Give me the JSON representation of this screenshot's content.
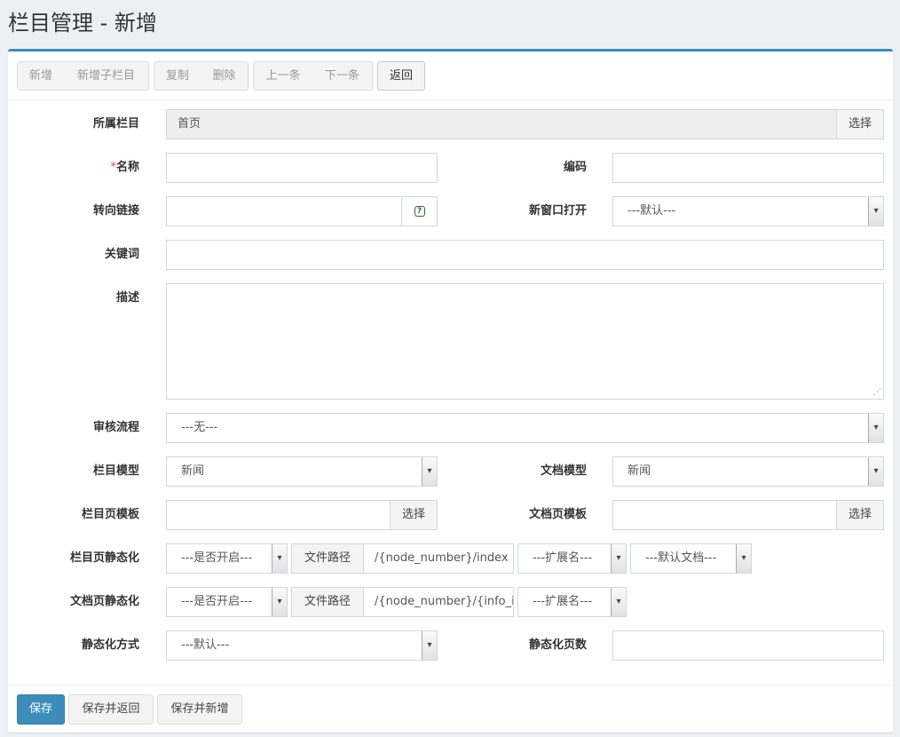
{
  "page": {
    "title": "栏目管理 - 新增"
  },
  "toolbar": {
    "add": "新增",
    "add_child": "新增子栏目",
    "copy": "复制",
    "delete": "删除",
    "prev": "上一条",
    "next": "下一条",
    "back": "返回"
  },
  "form": {
    "parent": {
      "label": "所属栏目",
      "value": "首页",
      "button": "选择"
    },
    "name": {
      "required_mark": "*",
      "label": "名称",
      "value": ""
    },
    "code": {
      "label": "编码",
      "value": ""
    },
    "redirect": {
      "label": "转向链接",
      "value": "",
      "help": "?"
    },
    "new_window": {
      "label": "新窗口打开",
      "selected": "---默认---"
    },
    "keywords": {
      "label": "关键词",
      "value": ""
    },
    "description": {
      "label": "描述",
      "value": ""
    },
    "workflow": {
      "label": "审核流程",
      "selected": "---无---"
    },
    "node_model": {
      "label": "栏目模型",
      "selected": "新闻"
    },
    "doc_model": {
      "label": "文档模型",
      "selected": "新闻"
    },
    "node_template": {
      "label": "栏目页模板",
      "value": "",
      "button": "选择"
    },
    "doc_template": {
      "label": "文档页模板",
      "value": "",
      "button": "选择"
    },
    "node_static": {
      "label": "栏目页静态化",
      "enable": "---是否开启---",
      "path_label": "文件路径",
      "path": "/{node_number}/index",
      "ext": "---扩展名---",
      "default_doc": "---默认文档---"
    },
    "doc_static": {
      "label": "文档页静态化",
      "enable": "---是否开启---",
      "path_label": "文件路径",
      "path": "/{node_number}/{info_i",
      "ext": "---扩展名---"
    },
    "static_method": {
      "label": "静态化方式",
      "selected": "---默认---"
    },
    "static_pages": {
      "label": "静态化页数",
      "value": ""
    }
  },
  "footer": {
    "save": "保存",
    "save_back": "保存并返回",
    "save_new": "保存并新增"
  },
  "colors": {
    "primary": "#3c8dbc",
    "background": "#ecf0f5",
    "required": "#dd4b39"
  }
}
